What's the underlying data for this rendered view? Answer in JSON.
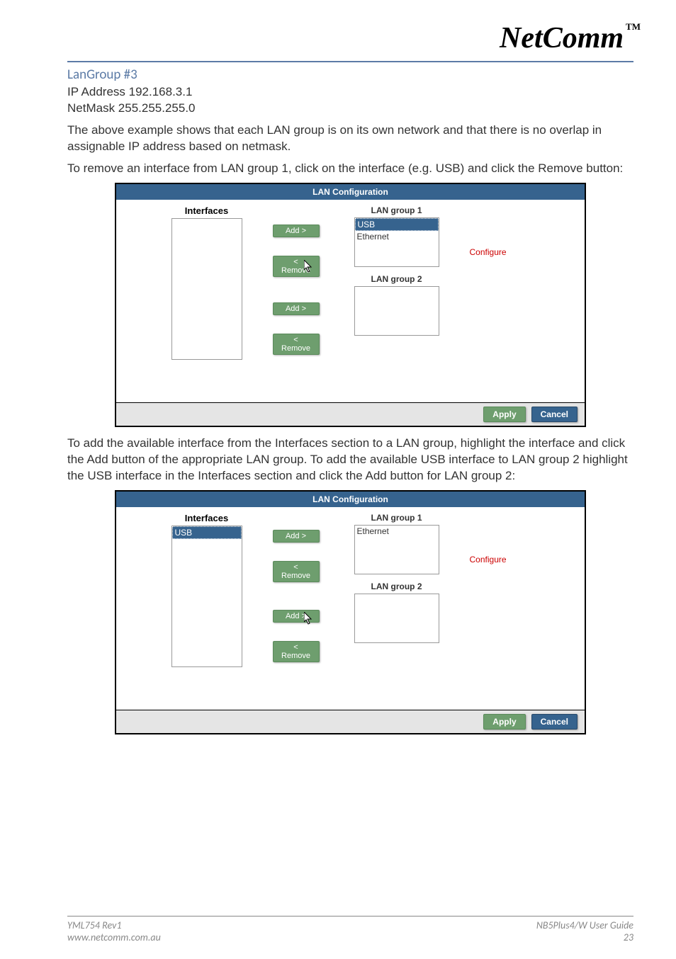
{
  "logo": {
    "text": "NetComm",
    "tm": "TM"
  },
  "section_title": "LanGroup #3",
  "ip_line": "IP Address 192.168.3.1",
  "mask_line": "NetMask 255.255.255.0",
  "para1": "The above example shows that each LAN group is on its own network and that there is no overlap in assignable IP address based on netmask.",
  "para2": "To remove an interface from LAN group 1, click on the interface (e.g. USB) and click the Remove button:",
  "para3": "To add the available interface from the Interfaces section to a LAN group, highlight the interface and click the Add button of the appropriate LAN group. To add the available USB interface to LAN group 2 highlight the USB interface in the Interfaces section and click the Add button for LAN group 2:",
  "shot": {
    "title": "LAN Configuration",
    "interfaces_label": "Interfaces",
    "lan1_label": "LAN group 1",
    "lan2_label": "LAN group 2",
    "add_btn": "Add >",
    "remove_btn": "< Remove",
    "configure_link": "Configure",
    "apply_btn": "Apply",
    "cancel_btn": "Cancel"
  },
  "shot1_data": {
    "interfaces": [],
    "lan1": [
      "USB",
      "Ethernet"
    ],
    "lan1_selected": "USB",
    "lan2": []
  },
  "shot2_data": {
    "interfaces": [
      "USB"
    ],
    "interfaces_selected": "USB",
    "lan1": [
      "Ethernet"
    ],
    "lan2": []
  },
  "footer": {
    "left1": "YML754 Rev1",
    "left2": "www.netcomm.com.au",
    "right1": "NB5Plus4/W User Guide",
    "right2": "23"
  }
}
